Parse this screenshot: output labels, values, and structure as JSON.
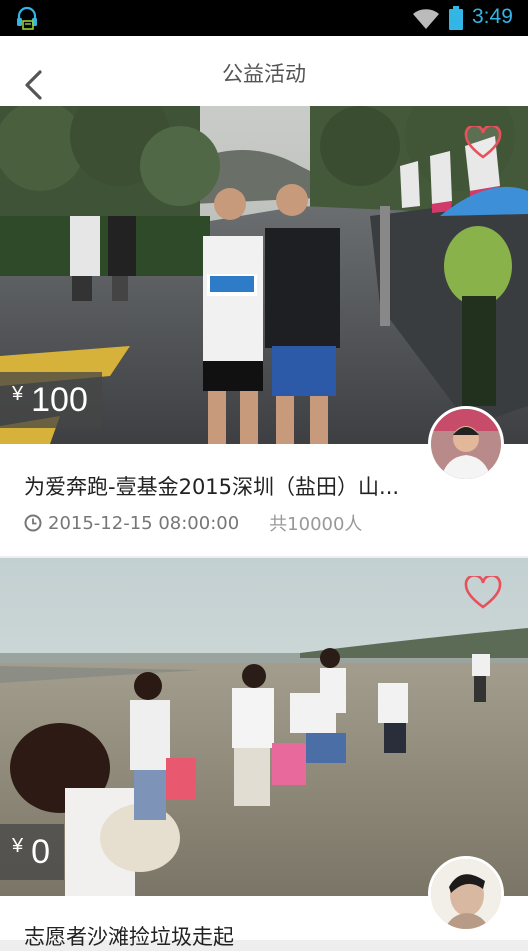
{
  "status_bar": {
    "time": "3:49",
    "accent": "#33b5e5"
  },
  "header": {
    "title": "公益活动",
    "back_icon": "chevron-left"
  },
  "activities": [
    {
      "price_symbol": "¥",
      "price": "100",
      "title": "为爱奔跑-壹基金2015深圳（盐田）山...",
      "date": "2015-12-15 08:00:00",
      "participants": "共10000人",
      "favorited": true
    },
    {
      "price_symbol": "¥",
      "price": "0",
      "title": "志愿者沙滩捡垃圾走起",
      "favorited": false
    }
  ]
}
